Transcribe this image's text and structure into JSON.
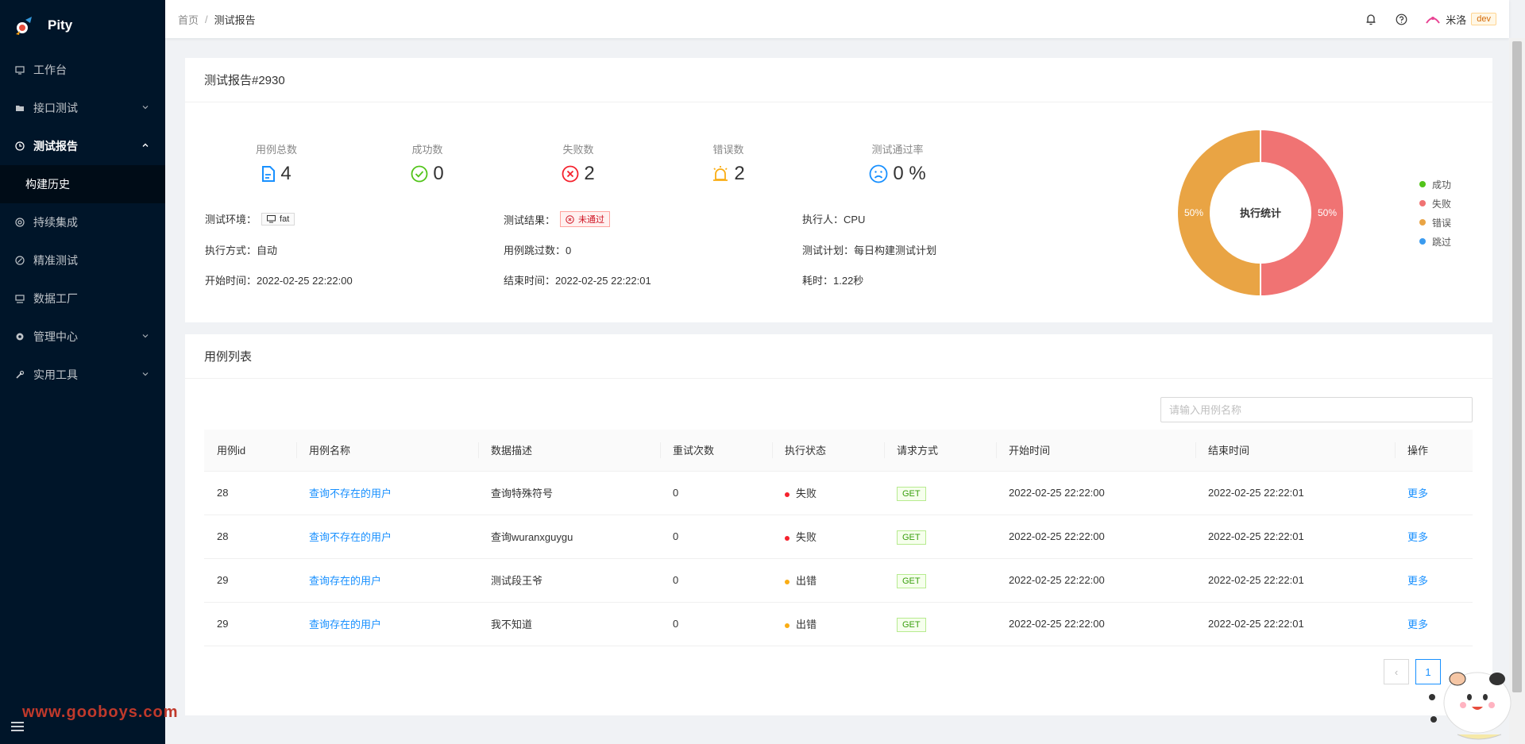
{
  "app": {
    "name": "Pity"
  },
  "sidebar": {
    "items": [
      {
        "label": "工作台",
        "icon": "monitor-icon"
      },
      {
        "label": "接口测试",
        "icon": "folder-icon",
        "chevron": "down"
      },
      {
        "label": "测试报告",
        "icon": "clock-icon",
        "chevron": "up",
        "open": true
      },
      {
        "label": "持续集成",
        "icon": "target-icon"
      },
      {
        "label": "精准测试",
        "icon": "link-icon"
      },
      {
        "label": "数据工厂",
        "icon": "factory-icon"
      },
      {
        "label": "管理中心",
        "icon": "gear-icon",
        "chevron": "down"
      },
      {
        "label": "实用工具",
        "icon": "tool-icon",
        "chevron": "down"
      }
    ],
    "submenu": [
      {
        "label": "构建历史"
      }
    ],
    "watermark": "www.gooboys.com"
  },
  "header": {
    "breadcrumb": [
      "首页",
      "测试报告"
    ],
    "user": "米洛",
    "env": "dev"
  },
  "report": {
    "title": "测试报告#2930",
    "stats": {
      "total": {
        "label": "用例总数",
        "value": "4"
      },
      "success": {
        "label": "成功数",
        "value": "0"
      },
      "failed": {
        "label": "失败数",
        "value": "2"
      },
      "error": {
        "label": "错误数",
        "value": "2"
      },
      "pass_rate": {
        "label": "测试通过率",
        "value": "0 %"
      }
    },
    "info": {
      "env_label": "测试环境：",
      "env_value": "fat",
      "result_label": "测试结果：",
      "result_value": "未通过",
      "executor": "执行人：CPU",
      "mode": "执行方式：自动",
      "skipped": "用例跳过数：0",
      "plan": "测试计划：每日构建测试计划",
      "start": "开始时间：2022-02-25 22:22:00",
      "end": "结束时间：2022-02-25 22:22:01",
      "cost": "耗时：1.22秒"
    }
  },
  "chart_data": {
    "type": "pie",
    "title": "执行统计",
    "categories": [
      "成功",
      "失败",
      "错误",
      "跳过"
    ],
    "values": [
      0,
      2,
      2,
      0
    ],
    "labels": [
      "50%",
      "50%"
    ],
    "colors": {
      "成功": "#52c41a",
      "失败": "#f07373",
      "错误": "#e9a444",
      "跳过": "#3b9bef"
    },
    "legend_position": "right"
  },
  "cases": {
    "title": "用例列表",
    "search_placeholder": "请输入用例名称",
    "columns": [
      "用例id",
      "用例名称",
      "数据描述",
      "重试次数",
      "执行状态",
      "请求方式",
      "开始时间",
      "结束时间",
      "操作"
    ],
    "rows": [
      {
        "id": "28",
        "name": "查询不存在的用户",
        "desc": "查询特殊符号",
        "retry": "0",
        "status": "失败",
        "status_color": "#f5222d",
        "method": "GET",
        "start": "2022-02-25 22:22:00",
        "end": "2022-02-25 22:22:01",
        "action": "更多"
      },
      {
        "id": "28",
        "name": "查询不存在的用户",
        "desc": "查询wuranxguygu",
        "retry": "0",
        "status": "失败",
        "status_color": "#f5222d",
        "method": "GET",
        "start": "2022-02-25 22:22:00",
        "end": "2022-02-25 22:22:01",
        "action": "更多"
      },
      {
        "id": "29",
        "name": "查询存在的用户",
        "desc": "测试段王爷",
        "retry": "0",
        "status": "出错",
        "status_color": "#faad14",
        "method": "GET",
        "start": "2022-02-25 22:22:00",
        "end": "2022-02-25 22:22:01",
        "action": "更多"
      },
      {
        "id": "29",
        "name": "查询存在的用户",
        "desc": "我不知道",
        "retry": "0",
        "status": "出错",
        "status_color": "#faad14",
        "method": "GET",
        "start": "2022-02-25 22:22:00",
        "end": "2022-02-25 22:22:01",
        "action": "更多"
      }
    ],
    "pagination": {
      "current": "1",
      "prev": "‹"
    }
  }
}
